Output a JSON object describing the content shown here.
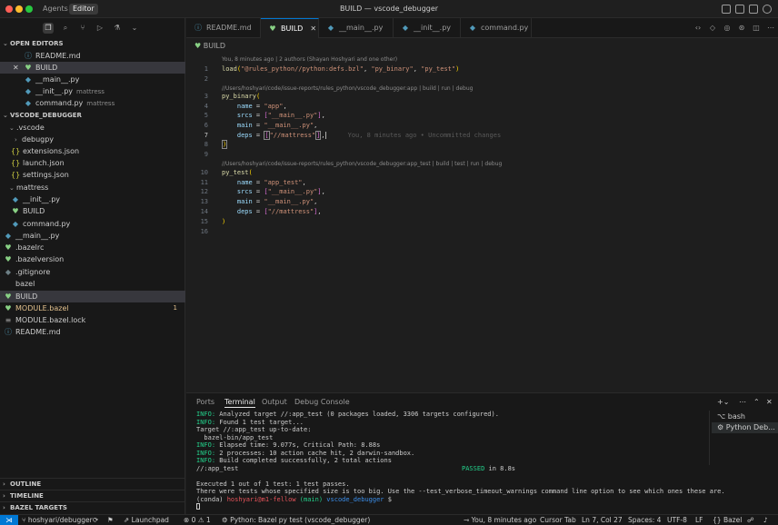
{
  "titlebar": {
    "agents": "Agents",
    "editor": "Editor",
    "title": "BUILD — vscode_debugger"
  },
  "sidebar": {
    "open_editors_label": "OPEN EDITORS",
    "open_editors": [
      {
        "name": "README.md",
        "icon": "info-icon",
        "hint": ""
      },
      {
        "name": "BUILD",
        "icon": "bazel-icon",
        "hint": ""
      },
      {
        "name": "__main__.py",
        "icon": "python-icon",
        "hint": ""
      },
      {
        "name": "__init__.py",
        "icon": "python-icon",
        "hint": "mattress"
      },
      {
        "name": "command.py",
        "icon": "python-icon",
        "hint": "mattress"
      }
    ],
    "project_label": "VSCODE_DEBUGGER",
    "tree": [
      {
        "name": ".vscode"
      },
      {
        "name": "debugpy"
      },
      {
        "name": "extensions.json"
      },
      {
        "name": "launch.json"
      },
      {
        "name": "settings.json"
      },
      {
        "name": "mattress"
      },
      {
        "name": "__init__.py"
      },
      {
        "name": "BUILD"
      },
      {
        "name": "command.py"
      },
      {
        "name": "__main__.py"
      },
      {
        "name": ".bazelrc"
      },
      {
        "name": ".bazelversion"
      },
      {
        "name": ".gitignore"
      },
      {
        "name": "bazel"
      },
      {
        "name": "BUILD"
      },
      {
        "name": "MODULE.bazel",
        "badge": "1"
      },
      {
        "name": "MODULE.bazel.lock"
      },
      {
        "name": "README.md"
      }
    ],
    "outline": "OUTLINE",
    "timeline": "TIMELINE",
    "bazel_targets": "BAZEL TARGETS"
  },
  "tabs": [
    {
      "label": "README.md"
    },
    {
      "label": "BUILD"
    },
    {
      "label": "__main__.py"
    },
    {
      "label": "__init__.py"
    },
    {
      "label": "command.py"
    }
  ],
  "breadcrumb": "BUILD",
  "editor": {
    "lens_top": "You, 8 minutes ago | 2 authors (Shayan Hoshyari and one other)",
    "lens_app": "//Users/hoshyari/code/issue-reports/rules_python/vscode_debugger:app | build | run | debug",
    "lens_test": "//Users/hoshyari/code/issue-reports/rules_python/vscode_debugger:app_test | build | test | run | debug",
    "blame": "You, 8 minutes ago • Uncommitted changes",
    "line_numbers": [
      "1",
      "2",
      "3",
      "4",
      "5",
      "6",
      "7",
      "8",
      "9",
      "10",
      "11",
      "12",
      "13",
      "14",
      "15",
      "16"
    ],
    "load_fn": "load",
    "load_args": [
      "\"@rules_python//python:defs.bzl\"",
      "\"py_binary\"",
      "\"py_test\""
    ],
    "py_binary": "py_binary",
    "py_test": "py_test",
    "name_key": "name",
    "srcs_key": "srcs",
    "main_key": "main",
    "deps_key": "deps",
    "app_name": "\"app\"",
    "test_name": "\"app_test\"",
    "srcs_val": "\"__main__.py\"",
    "main_val": "\"__main__.py\"",
    "deps_val": "\"//mattress\""
  },
  "panel": {
    "tabs": [
      "Ports",
      "Terminal",
      "Output",
      "Debug Console"
    ],
    "terminals": [
      "bash",
      "Python Deb..."
    ],
    "lines": [
      {
        "prefix": "INFO:",
        "text": " Analyzed target //:app_test (0 packages loaded, 3306 targets configured)."
      },
      {
        "prefix": "INFO:",
        "text": " Found 1 test target..."
      },
      {
        "prefix": "",
        "text": "Target //:app_test up-to-date:"
      },
      {
        "prefix": "",
        "text": "  bazel-bin/app_test"
      },
      {
        "prefix": "INFO:",
        "text": " Elapsed time: 9.077s, Critical Path: 8.88s"
      },
      {
        "prefix": "INFO:",
        "text": " 2 processes: 10 action cache hit, 2 darwin-sandbox."
      },
      {
        "prefix": "INFO:",
        "text": " Build completed successfully, 2 total actions"
      }
    ],
    "test_target": "//:app_test",
    "passed": "PASSED",
    "passed_time": " in 8.8s",
    "executed": "Executed 1 out of 1 test: 1 test passes.",
    "warning": "There were tests whose specified size is too big. Use the --test_verbose_timeout_warnings command line option to see which ones these are.",
    "prompt_conda": "(conda) ",
    "prompt_user": "hoshyari@m1-fellow",
    "prompt_branch": " (main)",
    "prompt_dir": " vscode_debugger",
    "prompt_sign": " $"
  },
  "status": {
    "branch": "hoshyari/debugger",
    "launchpad": "Launchpad",
    "problems": "0 ⚠ 1",
    "debug": "Python: Bazel py test (vscode_debugger)",
    "blame": "You, 8 minutes ago",
    "cursor_tab": "Cursor Tab",
    "position": "Ln 7, Col 27",
    "spaces": "Spaces: 4",
    "encoding": "UTF-8",
    "eol": "LF",
    "language": "Bazel"
  },
  "colors": {
    "accent": "#0078d4",
    "bazel_green": "#89d185",
    "python_blue": "#519aba",
    "modified": "#e2c08d"
  }
}
